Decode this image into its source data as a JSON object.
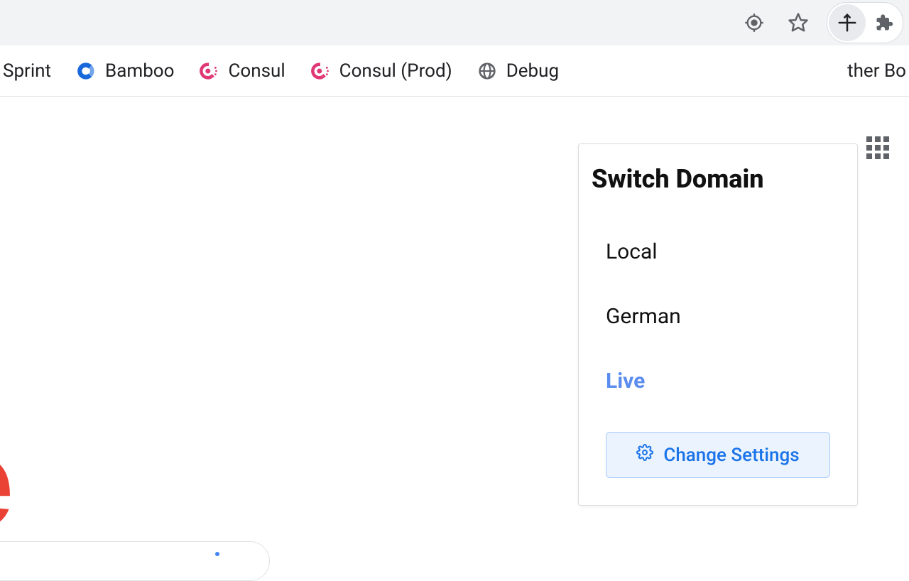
{
  "bookmarks": {
    "items": [
      {
        "label": "Sprint"
      },
      {
        "label": "Bamboo"
      },
      {
        "label": "Consul"
      },
      {
        "label": "Consul (Prod)"
      },
      {
        "label": "Debug"
      }
    ],
    "other_label": "ther Bo"
  },
  "popup": {
    "title": "Switch Domain",
    "domains": [
      {
        "label": "Local",
        "active": false
      },
      {
        "label": "German",
        "active": false
      },
      {
        "label": "Live",
        "active": true
      }
    ],
    "settings_label": "Change Settings"
  },
  "colors": {
    "accent": "#1a73e8",
    "google_red": "#ea4335"
  }
}
